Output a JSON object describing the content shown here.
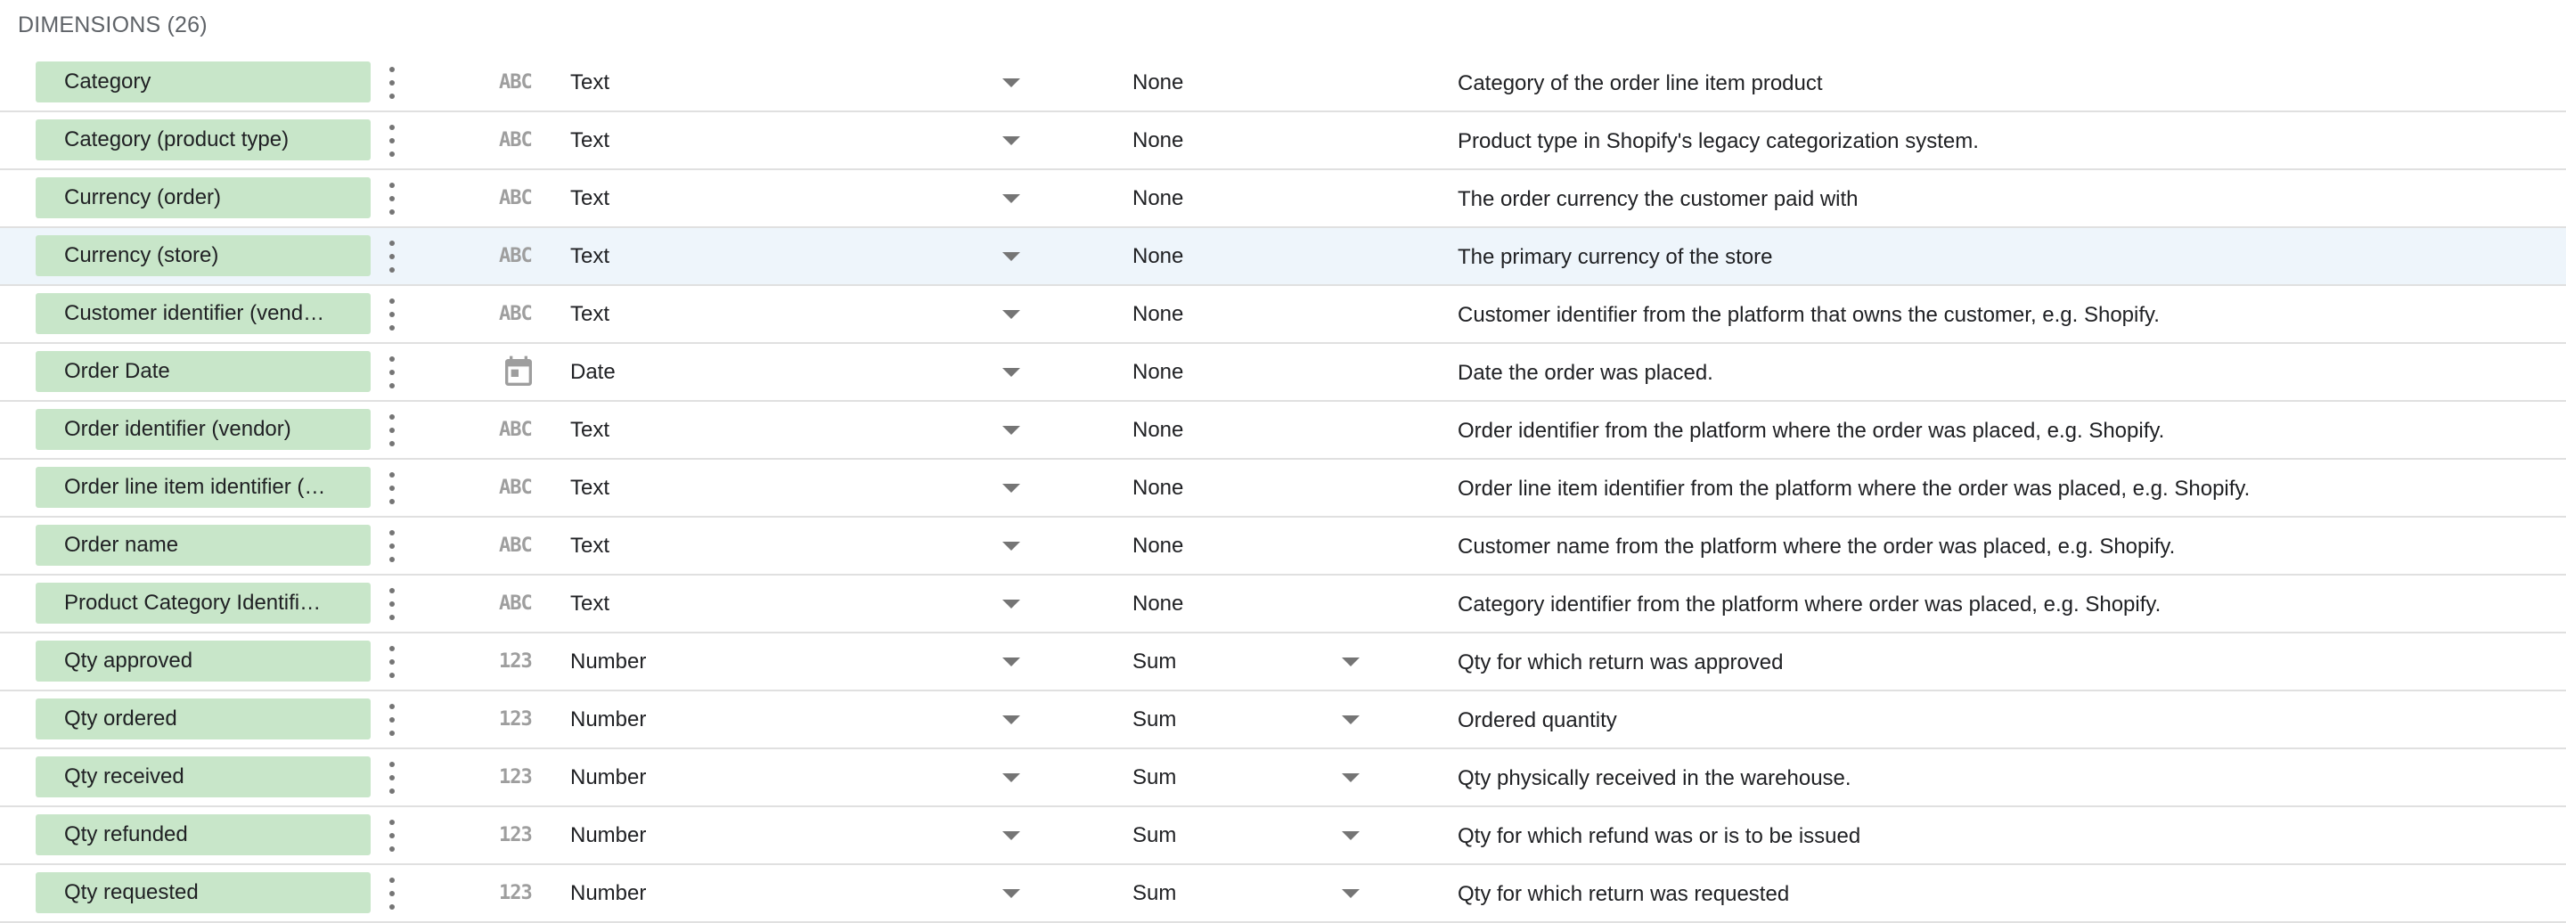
{
  "section": {
    "title": "DIMENSIONS (26)"
  },
  "rows": [
    {
      "name": "Category",
      "type_icon": "abc-icon",
      "type": "Text",
      "aggregation": "None",
      "agg_editable": false,
      "description": "Category of the order line item product",
      "hover": false
    },
    {
      "name": "Category (product type)",
      "type_icon": "abc-icon",
      "type": "Text",
      "aggregation": "None",
      "agg_editable": false,
      "description": "Product type in Shopify's legacy categorization system.",
      "hover": false
    },
    {
      "name": "Currency (order)",
      "type_icon": "abc-icon",
      "type": "Text",
      "aggregation": "None",
      "agg_editable": false,
      "description": "The order currency the customer paid with",
      "hover": false
    },
    {
      "name": "Currency (store)",
      "type_icon": "abc-icon",
      "type": "Text",
      "aggregation": "None",
      "agg_editable": false,
      "description": "The primary currency of the store",
      "hover": true
    },
    {
      "name": "Customer identifier (vend…",
      "type_icon": "abc-icon",
      "type": "Text",
      "aggregation": "None",
      "agg_editable": false,
      "description": "Customer identifier from the platform that owns the customer, e.g. Shopify.",
      "hover": false
    },
    {
      "name": "Order Date",
      "type_icon": "calendar-icon",
      "type": "Date",
      "aggregation": "None",
      "agg_editable": false,
      "description": "Date the order was placed.",
      "hover": false
    },
    {
      "name": "Order identifier (vendor)",
      "type_icon": "abc-icon",
      "type": "Text",
      "aggregation": "None",
      "agg_editable": false,
      "description": "Order identifier from the platform where the order was placed, e.g. Shopify.",
      "hover": false
    },
    {
      "name": "Order line item identifier (…",
      "type_icon": "abc-icon",
      "type": "Text",
      "aggregation": "None",
      "agg_editable": false,
      "description": "Order line item identifier from the platform where the order was placed, e.g. Shopify.",
      "hover": false
    },
    {
      "name": "Order name",
      "type_icon": "abc-icon",
      "type": "Text",
      "aggregation": "None",
      "agg_editable": false,
      "description": "Customer name from the platform where the order was placed, e.g. Shopify.",
      "hover": false
    },
    {
      "name": "Product Category Identifi…",
      "type_icon": "abc-icon",
      "type": "Text",
      "aggregation": "None",
      "agg_editable": false,
      "description": "Category identifier from the platform where order was placed, e.g. Shopify.",
      "hover": false
    },
    {
      "name": "Qty approved",
      "type_icon": "number-icon",
      "type": "Number",
      "aggregation": "Sum",
      "agg_editable": true,
      "description": "Qty for which return was approved",
      "hover": false
    },
    {
      "name": "Qty ordered",
      "type_icon": "number-icon",
      "type": "Number",
      "aggregation": "Sum",
      "agg_editable": true,
      "description": "Ordered quantity",
      "hover": false
    },
    {
      "name": "Qty received",
      "type_icon": "number-icon",
      "type": "Number",
      "aggregation": "Sum",
      "agg_editable": true,
      "description": "Qty physically received in the warehouse.",
      "hover": false
    },
    {
      "name": "Qty refunded",
      "type_icon": "number-icon",
      "type": "Number",
      "aggregation": "Sum",
      "agg_editable": true,
      "description": "Qty for which refund was or is to be issued",
      "hover": false
    },
    {
      "name": "Qty requested",
      "type_icon": "number-icon",
      "type": "Number",
      "aggregation": "Sum",
      "agg_editable": true,
      "description": "Qty for which return was requested",
      "hover": false
    }
  ],
  "icons": {
    "abc_glyph": "ABC",
    "number_glyph": "123"
  },
  "colors": {
    "chip": "#c8e6c9",
    "hover_row": "#eef5fb",
    "icon": "#9e9e9e"
  }
}
